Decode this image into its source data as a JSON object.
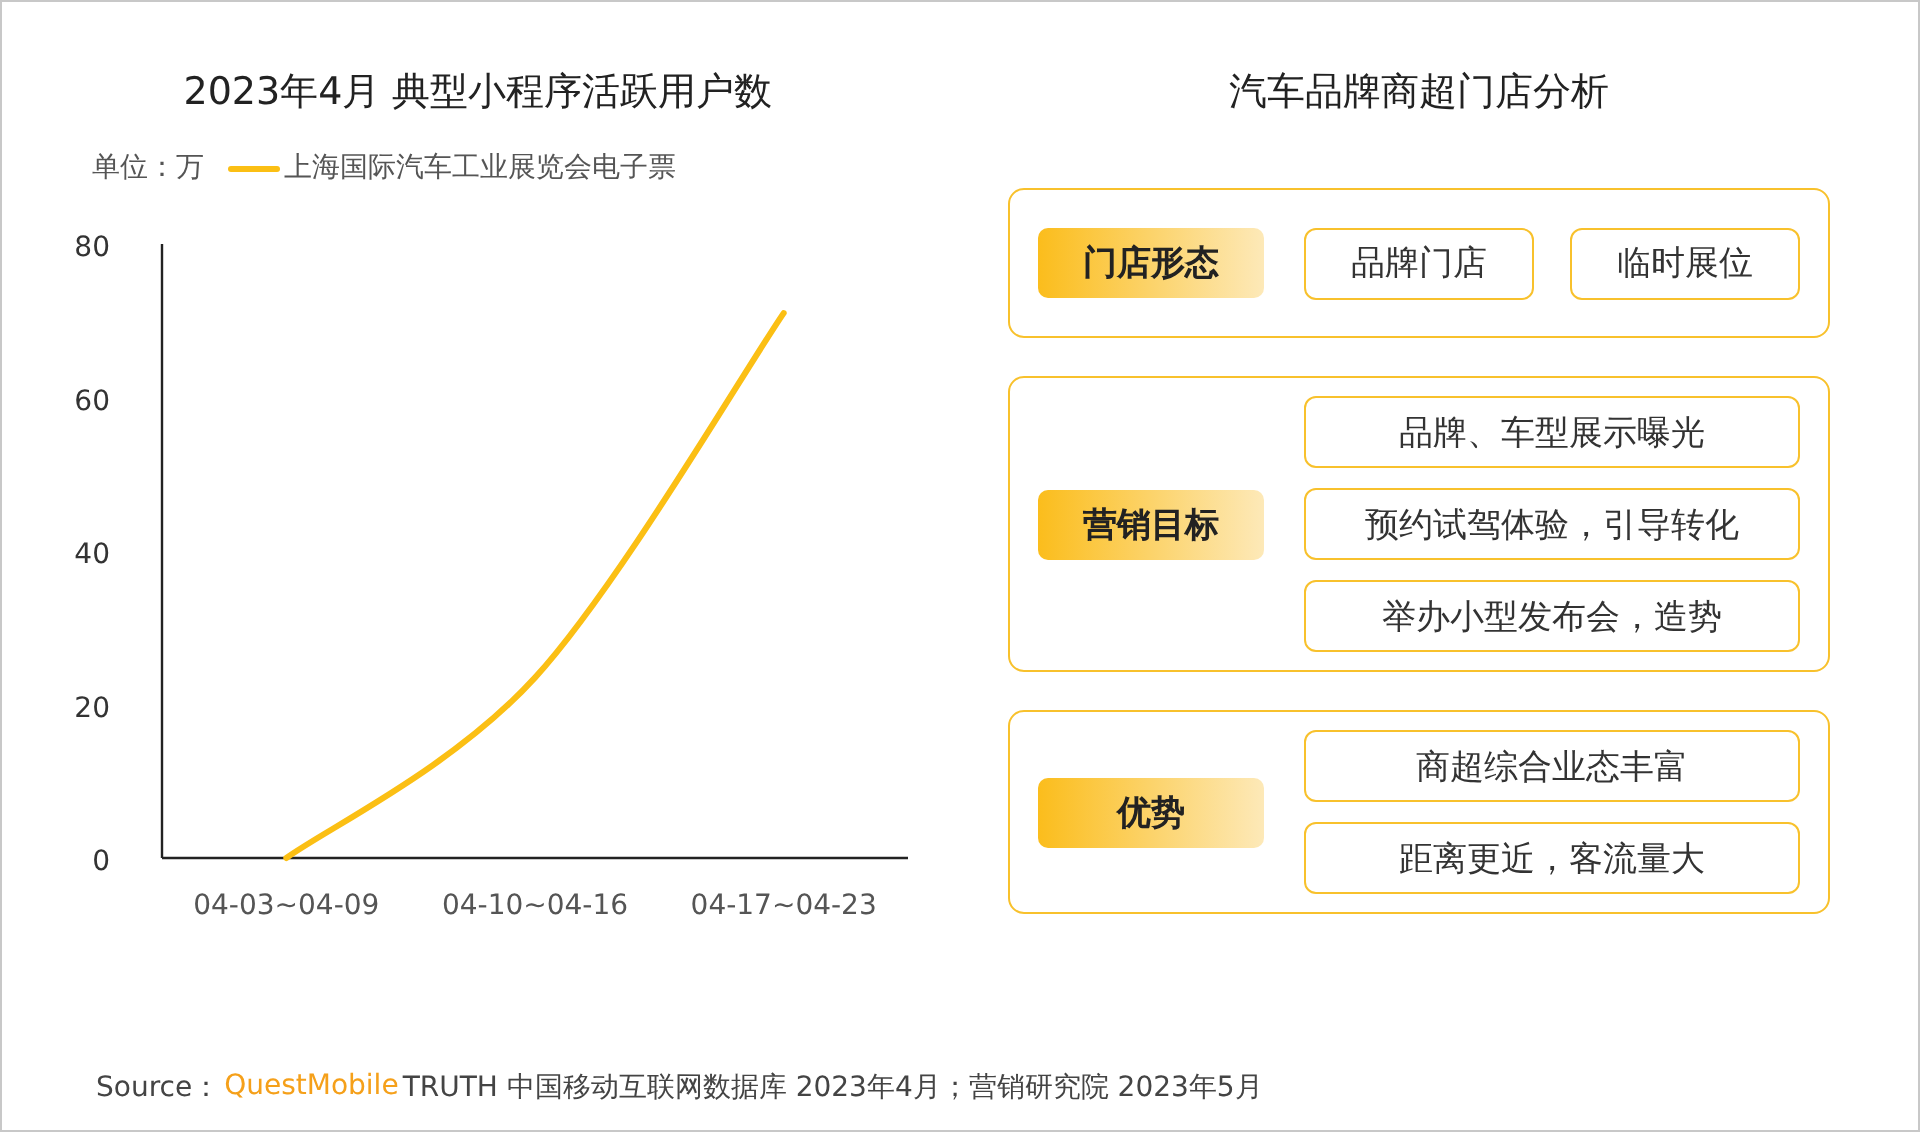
{
  "left_title": "2023年4月 典型小程序活跃用户数",
  "unit": "单位：万",
  "chart_data": {
    "type": "line",
    "categories": [
      "04-03~04-09",
      "04-10~04-16",
      "04-17~04-23"
    ],
    "yticks": [
      0,
      20,
      40,
      60,
      80
    ],
    "ylim": [
      0,
      80
    ],
    "series": [
      {
        "name": "上海国际汽车工业展览会电子票",
        "color": "#fbbf14",
        "values": [
          0,
          23.5,
          71
        ]
      }
    ]
  },
  "right_title": "汽车品牌商超门店分析",
  "sections": [
    {
      "label": "门店形态",
      "kind": "row",
      "items": [
        "品牌门店",
        "临时展位"
      ]
    },
    {
      "label": "营销目标",
      "kind": "column",
      "items": [
        "品牌、车型展示曝光",
        "预约试驾体验，引导转化",
        "举办小型发布会，造势"
      ]
    },
    {
      "label": "优势",
      "kind": "column",
      "items": [
        "商超综合业态丰富",
        "距离更近，客流量大"
      ]
    }
  ],
  "source": {
    "label": "Source：",
    "brand": "QuestMobile",
    "text": "TRUTH 中国移动互联网数据库 2023年4月；营销研究院 2023年5月"
  }
}
